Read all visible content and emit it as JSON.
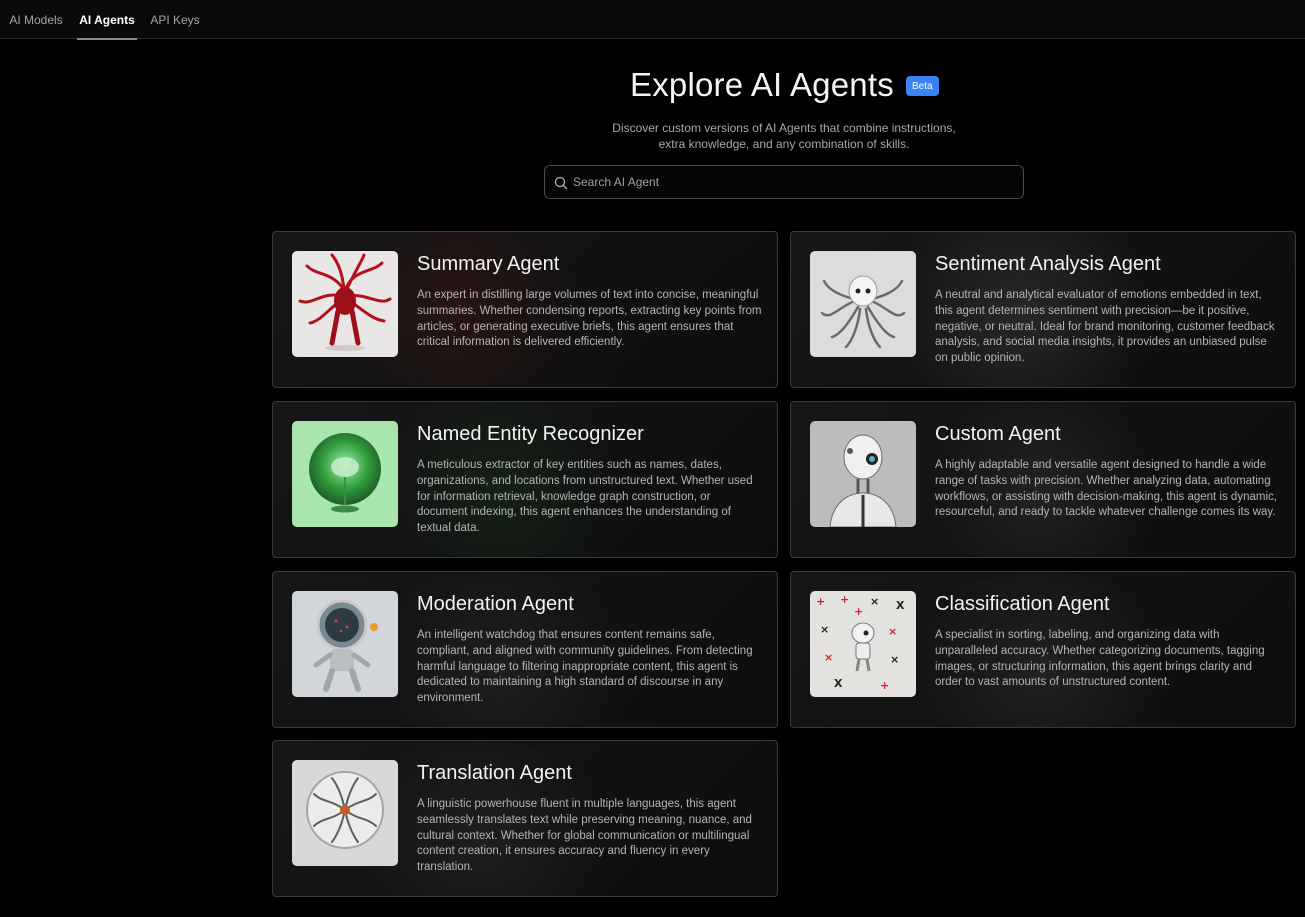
{
  "nav": {
    "tabs": [
      {
        "label": "AI Models"
      },
      {
        "label": "AI Agents"
      },
      {
        "label": "API Keys"
      }
    ]
  },
  "hero": {
    "title": "Explore AI Agents",
    "badge": "Beta",
    "subtitle_line1": "Discover custom versions of AI Agents that combine instructions,",
    "subtitle_line2": "extra knowledge, and any combination of skills."
  },
  "search": {
    "placeholder": "Search AI Agent",
    "value": ""
  },
  "agents": [
    {
      "name": "Summary Agent",
      "description": "An expert in distilling large volumes of text into concise, meaningful summaries. Whether condensing reports, extracting key points from articles, or generating executive briefs, this agent ensures that critical information is delivered efficiently.",
      "image": "red-tentacle-creature"
    },
    {
      "name": "Sentiment Analysis Agent",
      "description": "A neutral and analytical evaluator of emotions embedded in text, this agent determines sentiment with precision—be it positive, negative, or neutral. Ideal for brand monitoring, customer feedback analysis, and social media insights, it provides an unbiased pulse on public opinion.",
      "image": "silver-octopus-robot"
    },
    {
      "name": "Named Entity Recognizer",
      "description": "A meticulous extractor of key entities such as names, dates, organizations, and locations from unstructured text. Whether used for information retrieval, knowledge graph construction, or document indexing, this agent enhances the understanding of textual data.",
      "image": "green-glass-brain-orb"
    },
    {
      "name": "Custom Agent",
      "description": "A highly adaptable and versatile agent designed to handle a wide range of tasks with precision. Whether analyzing data, automating workflows, or assisting with decision-making, this agent is dynamic, resourceful, and ready to tackle whatever challenge comes its way.",
      "image": "white-humanoid-robot"
    },
    {
      "name": "Moderation Agent",
      "description": "An intelligent watchdog that ensures content remains safe, compliant, and aligned with community guidelines. From detecting harmful language to filtering inappropriate content, this agent is dedicated to maintaining a high standard of discourse in any environment.",
      "image": "astronaut-robot"
    },
    {
      "name": "Classification Agent",
      "description": "A specialist in sorting, labeling, and organizing data with unparalleled accuracy. Whether categorizing documents, tagging images, or structuring information, this agent brings clarity and order to vast amounts of unstructured content.",
      "image": "robot-with-crosses"
    },
    {
      "name": "Translation Agent",
      "description": "A linguistic powerhouse fluent in multiple languages, this agent seamlessly translates text while preserving meaning, nuance, and cultural context. Whether for global communication or multilingual content creation, it ensures accuracy and fluency in every translation.",
      "image": "glass-orb-tentacles"
    }
  ],
  "colors": {
    "background": "#000000",
    "accent": "#3b82f6",
    "card_border": "#3a3a3a"
  }
}
